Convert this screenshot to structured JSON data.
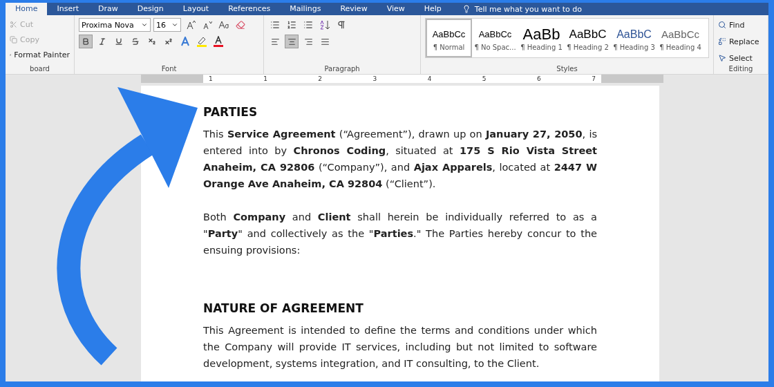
{
  "tabs": [
    {
      "label": "Home",
      "selected": true
    },
    {
      "label": "Insert",
      "selected": false
    },
    {
      "label": "Draw",
      "selected": false
    },
    {
      "label": "Design",
      "selected": false
    },
    {
      "label": "Layout",
      "selected": false
    },
    {
      "label": "References",
      "selected": false
    },
    {
      "label": "Mailings",
      "selected": false
    },
    {
      "label": "Review",
      "selected": false
    },
    {
      "label": "View",
      "selected": false
    },
    {
      "label": "Help",
      "selected": false
    }
  ],
  "tell_me": "Tell me what you want to do",
  "clipboard": {
    "label": "board",
    "items": [
      {
        "label": "Cut",
        "disabled": true
      },
      {
        "label": "Copy",
        "disabled": true
      },
      {
        "label": "Format Painter",
        "disabled": false
      }
    ]
  },
  "font": {
    "label": "Font",
    "name": "Proxima Nova",
    "size": "16",
    "buttons": [
      {
        "kind": "bold",
        "selected": true
      },
      {
        "kind": "italic",
        "selected": false
      },
      {
        "kind": "underline",
        "selected": false
      },
      {
        "kind": "strike",
        "selected": false
      },
      {
        "kind": "subscript",
        "selected": false
      },
      {
        "kind": "superscript",
        "selected": false
      }
    ]
  },
  "paragraph": {
    "label": "Paragraph",
    "align": [
      {
        "kind": "left",
        "selected": false
      },
      {
        "kind": "center",
        "selected": true
      },
      {
        "kind": "right",
        "selected": false
      },
      {
        "kind": "justify",
        "selected": false
      }
    ]
  },
  "styles": {
    "label": "Styles",
    "items": [
      {
        "preview": "AaBbCc",
        "name": "¶ Normal",
        "kind": "normal",
        "selected": true
      },
      {
        "preview": "AaBbCc",
        "name": "¶ No Spac...",
        "kind": "normal",
        "selected": false
      },
      {
        "preview": "AaBb",
        "name": "¶ Heading 1",
        "kind": "h1",
        "selected": false
      },
      {
        "preview": "AaBbC",
        "name": "¶ Heading 2",
        "kind": "h2",
        "selected": false
      },
      {
        "preview": "AaBbC",
        "name": "¶ Heading 3",
        "kind": "h3",
        "selected": false
      },
      {
        "preview": "AaBbCc",
        "name": "¶ Heading 4",
        "kind": "h4",
        "selected": false
      }
    ]
  },
  "editing": {
    "label": "Editing",
    "items": [
      {
        "label": "Find",
        "kind": "find"
      },
      {
        "label": "Replace",
        "kind": "replace"
      },
      {
        "label": "Select",
        "kind": "select"
      }
    ]
  },
  "ruler": {
    "labels": [
      "1",
      "1",
      "2",
      "3",
      "4",
      "5",
      "6",
      "7"
    ]
  },
  "document": [
    {
      "kind": "heading",
      "text": "PARTIES"
    },
    {
      "kind": "paragraph",
      "text": "This **Service Agreement** (“Agreement”), drawn up on **January 27, 2050**, is entered into by **Chronos Coding**, situated at **175 S Rio Vista Street Anaheim, CA 92806** (“Company”), and **Ajax Apparels**, located at **2447 W Orange Ave Anaheim, CA 92804** (“Client”)."
    },
    {
      "kind": "paragraph",
      "text": "Both **Company** and **Client** shall herein be individually referred to as a \"**Party**\" and collectively as the \"**Parties**.\" The Parties hereby concur to the ensuing provisions:"
    },
    {
      "kind": "spacer"
    },
    {
      "kind": "heading",
      "text": "NATURE OF AGREEMENT"
    },
    {
      "kind": "paragraph",
      "text": "This Agreement is intended to define the terms and conditions under which the Company will provide IT services, including but not limited to software development, systems integration, and IT consulting, to the Client."
    }
  ]
}
